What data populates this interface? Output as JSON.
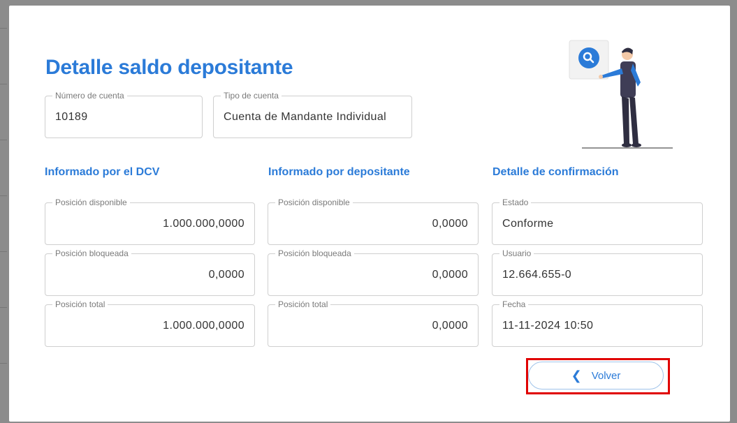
{
  "page": {
    "title": "Detalle saldo depositante"
  },
  "header_fields": {
    "account_number": {
      "label": "Número de cuenta",
      "value": "10189"
    },
    "account_type": {
      "label": "Tipo de cuenta",
      "value": "Cuenta de Mandante Individual"
    }
  },
  "sections": {
    "dcv": {
      "title": "Informado por el DCV",
      "available": {
        "label": "Posición disponible",
        "value": "1.000.000,0000"
      },
      "blocked": {
        "label": "Posición bloqueada",
        "value": "0,0000"
      },
      "total": {
        "label": "Posición total",
        "value": "1.000.000,0000"
      }
    },
    "depositante": {
      "title": "Informado por depositante",
      "available": {
        "label": "Posición disponible",
        "value": "0,0000"
      },
      "blocked": {
        "label": "Posición bloqueada",
        "value": "0,0000"
      },
      "total": {
        "label": "Posición total",
        "value": "0,0000"
      }
    },
    "confirmation": {
      "title": "Detalle de confirmación",
      "status": {
        "label": "Estado",
        "value": "Conforme"
      },
      "user": {
        "label": "Usuario",
        "value": "12.664.655-0"
      },
      "date": {
        "label": "Fecha",
        "value": "11-11-2024 10:50"
      }
    }
  },
  "actions": {
    "back_label": "Volver"
  },
  "colors": {
    "accent": "#2b7bd8",
    "highlight": "#e00000"
  },
  "icons": {
    "back": "chevron-left-icon",
    "illustration": "person-search-illustration"
  }
}
